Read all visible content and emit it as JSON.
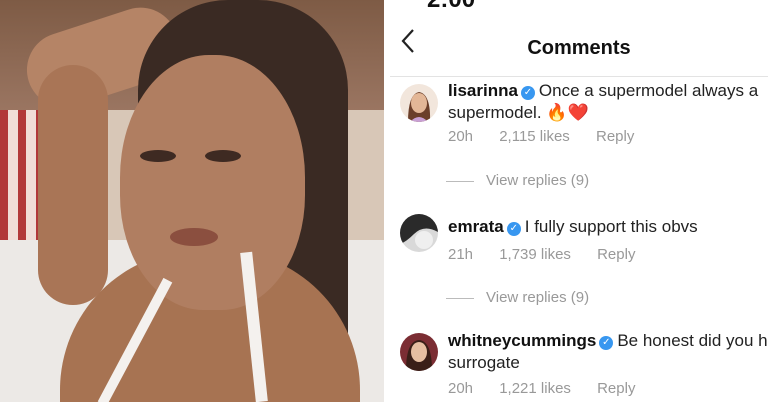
{
  "status_bar": {
    "time": "2:00"
  },
  "header": {
    "back_icon": "chevron-left-icon",
    "title": "Comments"
  },
  "comments": [
    {
      "username": "lisarinna",
      "verified": true,
      "text": "Once a supermodel always a supermodel.",
      "emoji": [
        "🔥",
        "❤️"
      ],
      "time": "20h",
      "likes": "2,115 likes",
      "reply_label": "Reply",
      "view_replies": "View replies (9)"
    },
    {
      "username": "emrata",
      "verified": true,
      "text": "I fully support this obvs",
      "time": "21h",
      "likes": "1,739 likes",
      "reply_label": "Reply",
      "view_replies": "View replies (9)"
    },
    {
      "username": "whitneycummings",
      "verified": true,
      "text": "Be honest did you h",
      "text_line2": "surrogate",
      "time": "20h",
      "likes": "1,221 likes",
      "reply_label": "Reply"
    }
  ],
  "colors": {
    "verified": "#3897f0",
    "meta": "#999999"
  }
}
